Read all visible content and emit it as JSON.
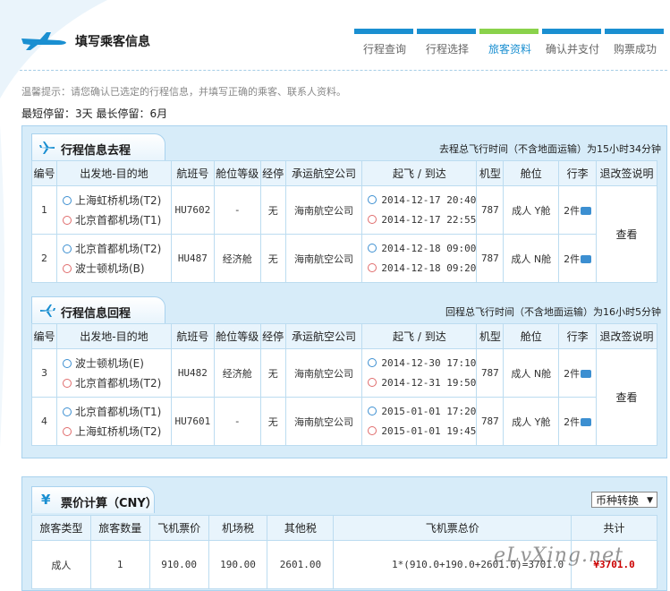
{
  "header": {
    "title": "填写乘客信息",
    "steps": [
      {
        "label": "行程查询",
        "active": false
      },
      {
        "label": "行程选择",
        "active": false
      },
      {
        "label": "旅客资料",
        "active": true
      },
      {
        "label": "确认并支付",
        "active": false
      },
      {
        "label": "购票成功",
        "active": false
      }
    ]
  },
  "tips": "温馨提示：请您确认已选定的行程信息，并填写正确的乘客、联系人资料。",
  "stay": "最短停留：3天  最长停留：6月",
  "outbound": {
    "title": "行程信息去程",
    "summary": "去程总飞行时间（不含地面运输）为15小时34分钟"
  },
  "inbound": {
    "title": "行程信息回程",
    "summary": "回程总飞行时间（不含地面运输）为16小时5分钟"
  },
  "itin_headers": [
    "编号",
    "出发地-目的地",
    "航班号",
    "舱位等级",
    "经停",
    "承运航空公司",
    "起飞 / 到达",
    "机型",
    "舱位",
    "行李",
    "退改签说明"
  ],
  "view_label": "查看",
  "outbound_rows": [
    {
      "no": "1",
      "from": "上海虹桥机场(T2)",
      "to": "北京首都机场(T1)",
      "flight": "HU7602",
      "cabin_class": "-",
      "stop": "无",
      "airline": "海南航空公司",
      "dep": "2014-12-17 20:40",
      "arr": "2014-12-17 22:55",
      "model": "787",
      "seat": "成人 Y舱",
      "bag": "2件"
    },
    {
      "no": "2",
      "from": "北京首都机场(T2)",
      "to": "波士顿机场(B)",
      "flight": "HU487",
      "cabin_class": "经济舱",
      "stop": "无",
      "airline": "海南航空公司",
      "dep": "2014-12-18 09:00",
      "arr": "2014-12-18 09:20",
      "model": "787",
      "seat": "成人 N舱",
      "bag": "2件"
    }
  ],
  "inbound_rows": [
    {
      "no": "3",
      "from": "波士顿机场(E)",
      "to": "北京首都机场(T2)",
      "flight": "HU482",
      "cabin_class": "经济舱",
      "stop": "无",
      "airline": "海南航空公司",
      "dep": "2014-12-30 17:10",
      "arr": "2014-12-31 19:50",
      "model": "787",
      "seat": "成人 N舱",
      "bag": "2件"
    },
    {
      "no": "4",
      "from": "北京首都机场(T1)",
      "to": "上海虹桥机场(T2)",
      "flight": "HU7601",
      "cabin_class": "-",
      "stop": "无",
      "airline": "海南航空公司",
      "dep": "2015-01-01 17:20",
      "arr": "2015-01-01 19:45",
      "model": "787",
      "seat": "成人 Y舱",
      "bag": "2件"
    }
  ],
  "price": {
    "title": "票价计算（CNY）",
    "currency_label": "币种转换",
    "headers": [
      "旅客类型",
      "旅客数量",
      "飞机票价",
      "机场税",
      "其他税",
      "飞机票总价",
      "共计"
    ],
    "row": {
      "type": "成人",
      "count": "1",
      "fare": "910.00",
      "airport_tax": "190.00",
      "other_tax": "2601.00",
      "formula": "1*(910.0+190.0+2601.0)=3701.0",
      "total": "¥3701.0"
    }
  },
  "watermark": "eLvXing.net",
  "colors": {
    "accent": "#1a8fd1",
    "active_step": "#8ad24b",
    "panel_bg": "#d7ecf9",
    "price": "#cc0000"
  }
}
